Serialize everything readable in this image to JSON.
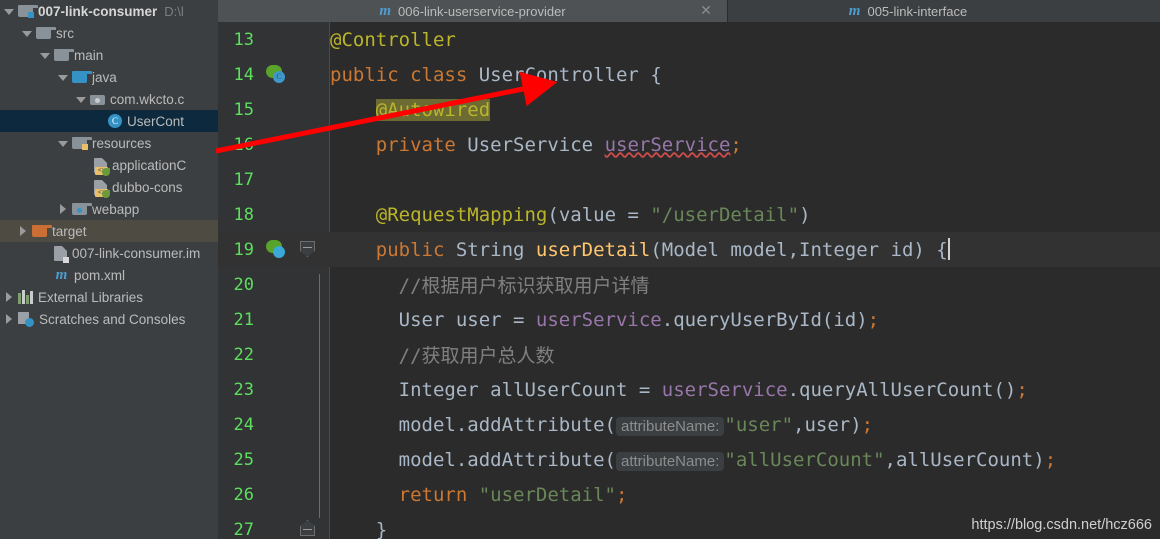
{
  "tabs": [
    {
      "label": "006-link-userservice-provider",
      "icon": "maven-m-icon",
      "active": true,
      "closable": true
    },
    {
      "label": "005-link-interface",
      "icon": "maven-m-icon",
      "active": false,
      "closable": false
    }
  ],
  "sidebar": {
    "items": [
      {
        "label": "007-link-consumer",
        "path": "D:\\l",
        "icon": "module-folder-icon",
        "arrow": "down",
        "indent": 0,
        "state": "normal",
        "bold": true
      },
      {
        "label": "src",
        "path": "",
        "icon": "folder-icon",
        "arrow": "down",
        "indent": 1,
        "state": "normal",
        "bold": false
      },
      {
        "label": "main",
        "path": "",
        "icon": "folder-icon",
        "arrow": "down",
        "indent": 2,
        "state": "normal",
        "bold": false
      },
      {
        "label": "java",
        "path": "",
        "icon": "source-folder-icon",
        "arrow": "down",
        "indent": 3,
        "state": "normal",
        "bold": false
      },
      {
        "label": "com.wkcto.c",
        "path": "",
        "icon": "package-icon",
        "arrow": "down",
        "indent": 4,
        "state": "normal",
        "bold": false
      },
      {
        "label": "UserCont",
        "path": "",
        "icon": "java-class-icon",
        "arrow": "blank",
        "indent": 5,
        "state": "selected",
        "bold": false
      },
      {
        "label": "resources",
        "path": "",
        "icon": "resources-folder-icon",
        "arrow": "down",
        "indent": 3,
        "state": "normal",
        "bold": false
      },
      {
        "label": "applicationC",
        "path": "",
        "icon": "spring-xml-icon",
        "arrow": "blank",
        "indent": 4,
        "state": "normal",
        "bold": false
      },
      {
        "label": "dubbo-cons",
        "path": "",
        "icon": "spring-xml-icon",
        "arrow": "blank",
        "indent": 4,
        "state": "normal",
        "bold": false
      },
      {
        "label": "webapp",
        "path": "",
        "icon": "webapp-folder-icon",
        "arrow": "right",
        "indent": 3,
        "state": "normal",
        "bold": false
      },
      {
        "label": "target",
        "path": "",
        "icon": "excluded-folder-icon",
        "arrow": "right",
        "indent": 2,
        "state": "hovered",
        "bold": false
      },
      {
        "label": "007-link-consumer.im",
        "path": "",
        "icon": "iml-file-icon",
        "arrow": "blank",
        "indent": 2,
        "state": "normal",
        "bold": false
      },
      {
        "label": "pom.xml",
        "path": "",
        "icon": "maven-m-icon",
        "arrow": "blank",
        "indent": 2,
        "state": "normal",
        "bold": false
      },
      {
        "label": "External Libraries",
        "path": "",
        "icon": "libraries-icon",
        "arrow": "right",
        "indent": 0,
        "state": "normal",
        "bold": false
      },
      {
        "label": "Scratches and Consoles",
        "path": "",
        "icon": "scratches-icon",
        "arrow": "right",
        "indent": 0,
        "state": "normal",
        "bold": false
      }
    ]
  },
  "editor": {
    "lines": [
      {
        "no": "13",
        "gutter": "",
        "fold": "",
        "current": false
      },
      {
        "no": "14",
        "gutter": "spring-bean",
        "fold": "",
        "current": false
      },
      {
        "no": "15",
        "gutter": "",
        "fold": "",
        "current": false
      },
      {
        "no": "16",
        "gutter": "",
        "fold": "",
        "current": false
      },
      {
        "no": "17",
        "gutter": "",
        "fold": "",
        "current": false
      },
      {
        "no": "18",
        "gutter": "",
        "fold": "",
        "current": false
      },
      {
        "no": "19",
        "gutter": "spring-bean",
        "fold": "top",
        "current": true
      },
      {
        "no": "20",
        "gutter": "",
        "fold": "",
        "current": false
      },
      {
        "no": "21",
        "gutter": "",
        "fold": "",
        "current": false
      },
      {
        "no": "22",
        "gutter": "",
        "fold": "",
        "current": false
      },
      {
        "no": "23",
        "gutter": "",
        "fold": "",
        "current": false
      },
      {
        "no": "24",
        "gutter": "",
        "fold": "",
        "current": false
      },
      {
        "no": "25",
        "gutter": "",
        "fold": "",
        "current": false
      },
      {
        "no": "26",
        "gutter": "",
        "fold": "",
        "current": false
      },
      {
        "no": "27",
        "gutter": "",
        "fold": "bottom",
        "current": false
      }
    ],
    "code": {
      "l13": "@Controller",
      "l14_kw": "public class ",
      "l14_cls": "UserController",
      "l14_brace": " {",
      "l15": "@Autowired",
      "l16_kw": "private ",
      "l16_type": "UserService ",
      "l16_field": "userService",
      "l16_semi": ";",
      "l18_ann": "@RequestMapping",
      "l18_p1": "(",
      "l18_param": "value",
      "l18_eq": " = ",
      "l18_str": "\"/userDetail\"",
      "l18_p2": ")",
      "l19_kw": "public ",
      "l19_ret": "String ",
      "l19_mth": "userDetail",
      "l19_args": "(Model model,Integer id) {",
      "l20": "//根据用户标识获取用户详情",
      "l21_a": "User user = ",
      "l21_svc": "userService",
      "l21_b": ".queryUserById(id)",
      "l21_semi": ";",
      "l22": "//获取用户总人数",
      "l23_a": "Integer allUserCount = ",
      "l23_svc": "userService",
      "l23_b": ".queryAllUserCount()",
      "l23_semi": ";",
      "l24_a": "model.addAttribute(",
      "l24_hint": "attributeName:",
      "l24_str": "\"user\"",
      "l24_b": ",user)",
      "l24_semi": ";",
      "l25_a": "model.addAttribute(",
      "l25_hint": "attributeName:",
      "l25_str": "\"allUserCount\"",
      "l25_b": ",allUserCount)",
      "l25_semi": ";",
      "l26_kw": "return ",
      "l26_str": "\"userDetail\"",
      "l26_semi": ";",
      "l27": "}"
    }
  },
  "watermark": {
    "text": "https://blog.csdn.net/hcz666"
  },
  "annotation": {
    "arrow_color": "#ff0000",
    "type": "red-arrow"
  },
  "colors": {
    "editor_bg": "#2b2b2b",
    "gutter_bg": "#313335",
    "sidebar_bg": "#3c3f41",
    "selection": "#0d293e",
    "line_number": "#5ddf5d",
    "keyword": "#cc7832",
    "annotation": "#bbb529",
    "string": "#6a8759",
    "comment": "#808080",
    "field": "#9876aa",
    "method": "#ffc66d",
    "default_text": "#a9b7c6",
    "autowired_highlight": "#6b6b32"
  }
}
